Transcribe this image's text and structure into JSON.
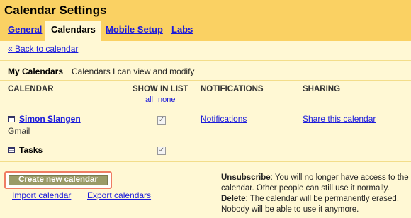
{
  "title": "Calendar Settings",
  "tabs": [
    {
      "label": "General",
      "active": false
    },
    {
      "label": "Calendars",
      "active": true
    },
    {
      "label": "Mobile Setup",
      "active": false
    },
    {
      "label": "Labs",
      "active": false
    }
  ],
  "back_link": "« Back to calendar",
  "section": {
    "title": "My Calendars",
    "subtitle": "Calendars I can view and modify"
  },
  "columns": {
    "calendar": "CALENDAR",
    "show_in_list": "SHOW IN LIST",
    "notifications": "NOTIFICATIONS",
    "sharing": "SHARING",
    "all": "all",
    "none": "none"
  },
  "calendars": [
    {
      "name": "Simon Slangen",
      "sub": "Gmail",
      "shown": true,
      "notifications": "Notifications",
      "sharing": "Share this calendar",
      "icon": "calendar-icon"
    },
    {
      "name": "Tasks",
      "sub": "",
      "shown": true,
      "notifications": "",
      "sharing": "",
      "icon": "calendar-icon"
    }
  ],
  "create_button": "Create new calendar",
  "import_link": "Import calendar",
  "export_link": "Export calendars",
  "info": {
    "unsubscribe_label": "Unsubscribe",
    "unsubscribe_text": ": You will no longer have access to the calendar. Other people can still use it normally.",
    "delete_label": "Delete",
    "delete_text": ": The calendar will be permanently erased. Nobody will be able to use it anymore."
  },
  "colors": {
    "header": "#fad163",
    "background": "#fff8d4",
    "link": "#1a1adb",
    "button": "#9a9b68",
    "highlight": "#ef7d63"
  }
}
